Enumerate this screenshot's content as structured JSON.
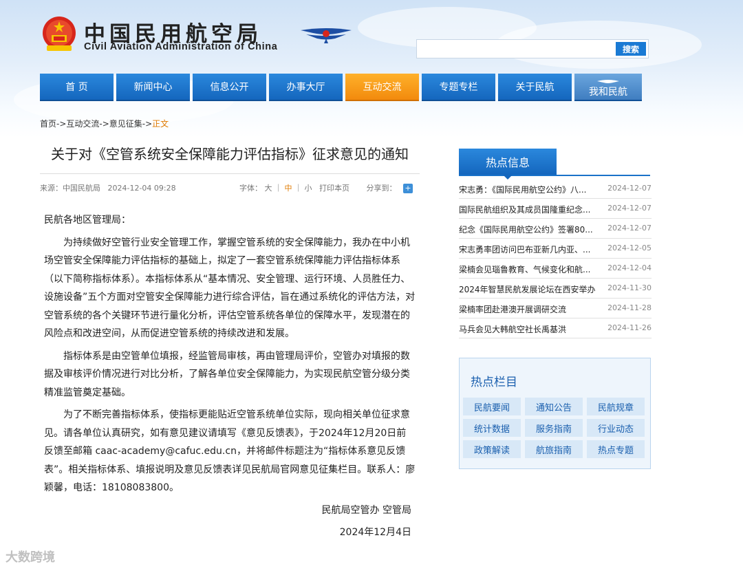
{
  "header": {
    "logo_cn": "中国民用航空局",
    "logo_en": "Civil Aviation Administration of China",
    "search": {
      "placeholder": "",
      "button": "搜索"
    }
  },
  "nav": {
    "items": [
      {
        "label": "首 页"
      },
      {
        "label": "新闻中心"
      },
      {
        "label": "信息公开"
      },
      {
        "label": "办事大厅"
      },
      {
        "label": "互动交流"
      },
      {
        "label": "专题专栏"
      },
      {
        "label": "关于民航"
      },
      {
        "label": "我和民航"
      }
    ],
    "active_index": 4
  },
  "breadcrumb": {
    "part1": "首页->互动交流->意见征集->",
    "current": "正文"
  },
  "article": {
    "title": "关于对《空管系统安全保障能力评估指标》征求意见的通知",
    "source": "来源：中国民航局",
    "date": "2024-12-04 09:28",
    "font_label": "字体：",
    "font_large": "大",
    "font_medium": "中",
    "font_small": "小",
    "print": "打印本页",
    "share": "分享到：",
    "salutation": "民航各地区管理局：",
    "p1": "为持续做好空管行业安全管理工作，掌握空管系统的安全保障能力，我办在中小机场空管安全保障能力评估指标的基础上，拟定了一套空管系统保障能力评估指标体系（以下简称指标体系）。本指标体系从“基本情况、安全管理、运行环境、人员胜任力、设施设备”五个方面对空管安全保障能力进行综合评估，旨在通过系统化的评估方法，对空管系统的各个关键环节进行量化分析，评估空管系统各单位的保障水平，发现潜在的风险点和改进空间，从而促进空管系统的持续改进和发展。",
    "p2": "指标体系是由空管单位填报，经监管局审核，再由管理局评价，空管办对填报的数据及审核评价情况进行对比分析，了解各单位安全保障能力，为实现民航空管分级分类精准监管奠定基础。",
    "p3": "为了不断完善指标体系，使指标更能贴近空管系统单位实际，现向相关单位征求意见。请各单位认真研究，如有意见建议请填写《意见反馈表》，于2024年12月20日前反馈至邮箱 caac-academy@cafuc.edu.cn，并将邮件标题注为“指标体系意见反馈表”。相关指标体系、填报说明及意见反馈表详见民航局官网意见征集栏目。联系人：廖颖馨，电话：18108083800。",
    "signature": "民航局空管办 空管局",
    "sign_date": "2024年12月4日"
  },
  "hot_info": {
    "title": "热点信息",
    "items": [
      {
        "text": "宋志勇：《国际民用航空公约》八...",
        "date": "2024-12-07"
      },
      {
        "text": "国际民航组织及其成员国隆重纪念...",
        "date": "2024-12-07"
      },
      {
        "text": "纪念《国际民用航空公约》签署80...",
        "date": "2024-12-07"
      },
      {
        "text": "宋志勇率团访问巴布亚新几内亚、...",
        "date": "2024-12-05"
      },
      {
        "text": "梁楠会见瑙鲁教育、气候变化和航...",
        "date": "2024-12-04"
      },
      {
        "text": "2024年智慧民航发展论坛在西安举办",
        "date": "2024-11-30"
      },
      {
        "text": "梁楠率团赴港澳开展调研交流",
        "date": "2024-11-28"
      },
      {
        "text": "马兵会见大韩航空社长禹基洪",
        "date": "2024-11-26"
      }
    ]
  },
  "hot_columns": {
    "title": "热点栏目",
    "items": [
      "民航要闻",
      "通知公告",
      "民航规章",
      "统计数据",
      "服务指南",
      "行业动态",
      "政策解读",
      "航旅指南",
      "热点专题"
    ]
  },
  "watermark": "大数跨境"
}
